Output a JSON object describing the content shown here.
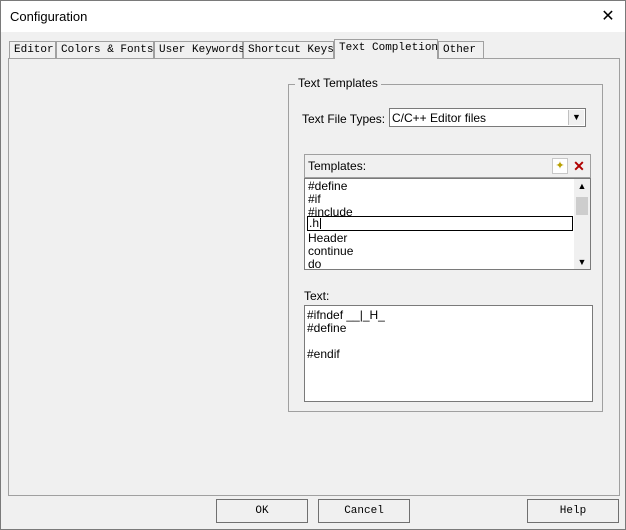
{
  "window": {
    "title": "Configuration",
    "close_glyph": "✕"
  },
  "tabs": [
    {
      "label": "Editor"
    },
    {
      "label": "Colors & Fonts"
    },
    {
      "label": "User Keywords"
    },
    {
      "label": "Shortcut Keys"
    },
    {
      "label": "Text Completion"
    },
    {
      "label": "Other"
    }
  ],
  "text_templates": {
    "group_title": "Text Templates",
    "file_types_label": "Text File Types:",
    "file_types_value": "C/C++ Editor files",
    "templates_label": "Templates:",
    "templates": [
      "#define",
      "#if",
      "#include",
      ".h",
      "Header",
      "continue",
      "do"
    ],
    "editing_item": ".h",
    "text_label": "Text:",
    "text_lines": [
      "#ifndef __|_H_",
      "#define",
      "",
      "#endif"
    ]
  },
  "buttons": {
    "ok": "OK",
    "cancel": "Cancel",
    "help": "Help"
  },
  "icons": {
    "new": "new-template-icon",
    "delete": "delete-template-icon",
    "dropdown": "chevron-down-icon"
  }
}
